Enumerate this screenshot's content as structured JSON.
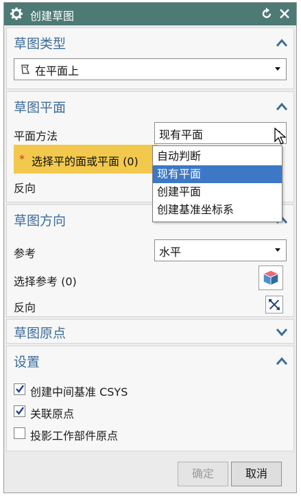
{
  "dialog": {
    "title": "创建草图"
  },
  "sketch_type": {
    "title": "草图类型",
    "selected": "在平面上"
  },
  "sketch_plane": {
    "title": "草图平面",
    "method_label": "平面方法",
    "method_value": "现有平面",
    "select_label": "选择平的面或平面 (0)",
    "reverse_label": "反向",
    "dropdown_options": [
      "自动判断",
      "现有平面",
      "创建平面",
      "创建基准坐标系"
    ],
    "selected_index": 1
  },
  "sketch_orientation": {
    "title": "草图方向",
    "reference_label": "参考",
    "reference_value": "水平",
    "select_reference_label": "选择参考 (0)",
    "reverse_label": "反向"
  },
  "sketch_origin": {
    "title": "草图原点"
  },
  "settings": {
    "title": "设置",
    "items": [
      {
        "label": "创建中间基准 CSYS",
        "checked": true
      },
      {
        "label": "关联原点",
        "checked": true
      },
      {
        "label": "投影工作部件原点",
        "checked": false
      }
    ]
  },
  "footer": {
    "ok_label": "确定",
    "cancel_label": "取消"
  },
  "colors": {
    "titlebar": "#4d7a75",
    "section_title": "#3a6c9b",
    "highlight": "#f2c94c",
    "dropdown_selected": "#3c78c6"
  }
}
